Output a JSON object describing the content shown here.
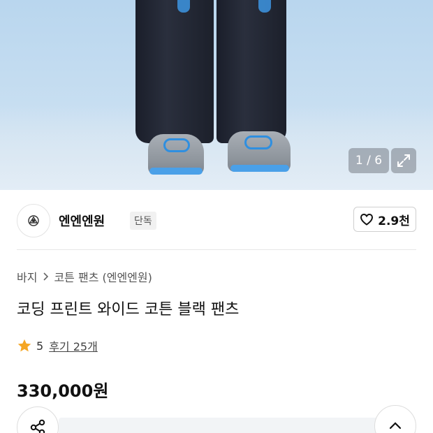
{
  "gallery": {
    "counter": "1 / 6",
    "expand_icon": "expand-icon"
  },
  "brand": {
    "name": "엔엔엔원",
    "badge": "단독",
    "like_count": "2.9천",
    "logo_icon": "brand-logo-icon",
    "heart_icon": "heart-icon"
  },
  "breadcrumb": {
    "items": [
      "바지",
      "코튼 팬츠 (엔엔엔원)"
    ],
    "separator_icon": "chevron-right-icon"
  },
  "product": {
    "title": "코딩 프린트 와이드 코튼 블랙 팬츠",
    "rating": "5",
    "review_link": "후기 25개",
    "price": "330,000원"
  },
  "colors": {
    "star": "#f5a623",
    "sky": "#b9d6ee"
  },
  "bottom": {
    "promo_text": "",
    "share_icon": "share-icon",
    "top_icon": "chevron-up-icon"
  }
}
